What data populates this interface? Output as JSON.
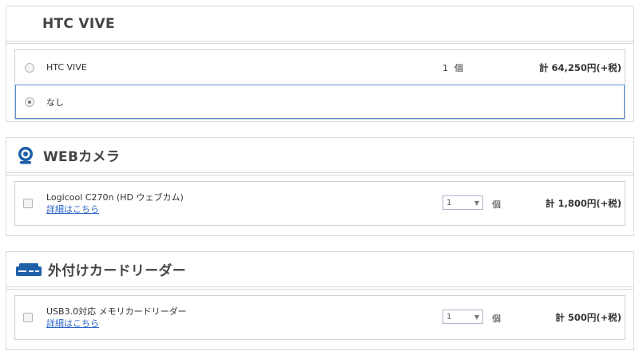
{
  "htc_section": {
    "title": "HTC VIVE",
    "options": [
      {
        "name": "HTC VIVE",
        "qty": "1",
        "unit": "個",
        "price": "計 64,250円(+税)"
      },
      {
        "name": "なし"
      }
    ]
  },
  "webcam_section": {
    "title": "WEBカメラ",
    "icon": "webcam-icon",
    "item": {
      "name": "Logicool C270n (HD ウェブカム)",
      "link": "詳細はこちら",
      "qty": "1",
      "unit": "個",
      "price": "計 1,800円(+税)"
    }
  },
  "cardreader_section": {
    "title": "外付けカードリーダー",
    "icon": "card-reader-icon",
    "item": {
      "name": "USB3.0対応 メモリカードリーダー",
      "link": "詳細はこちら",
      "qty": "1",
      "unit": "個",
      "price": "計 500円(+税)"
    }
  },
  "colors": {
    "accent": "#2a64c8",
    "icon_blue": "#1e5fa8",
    "border": "#d9d9d9",
    "selected_border": "#5a8fd0"
  }
}
